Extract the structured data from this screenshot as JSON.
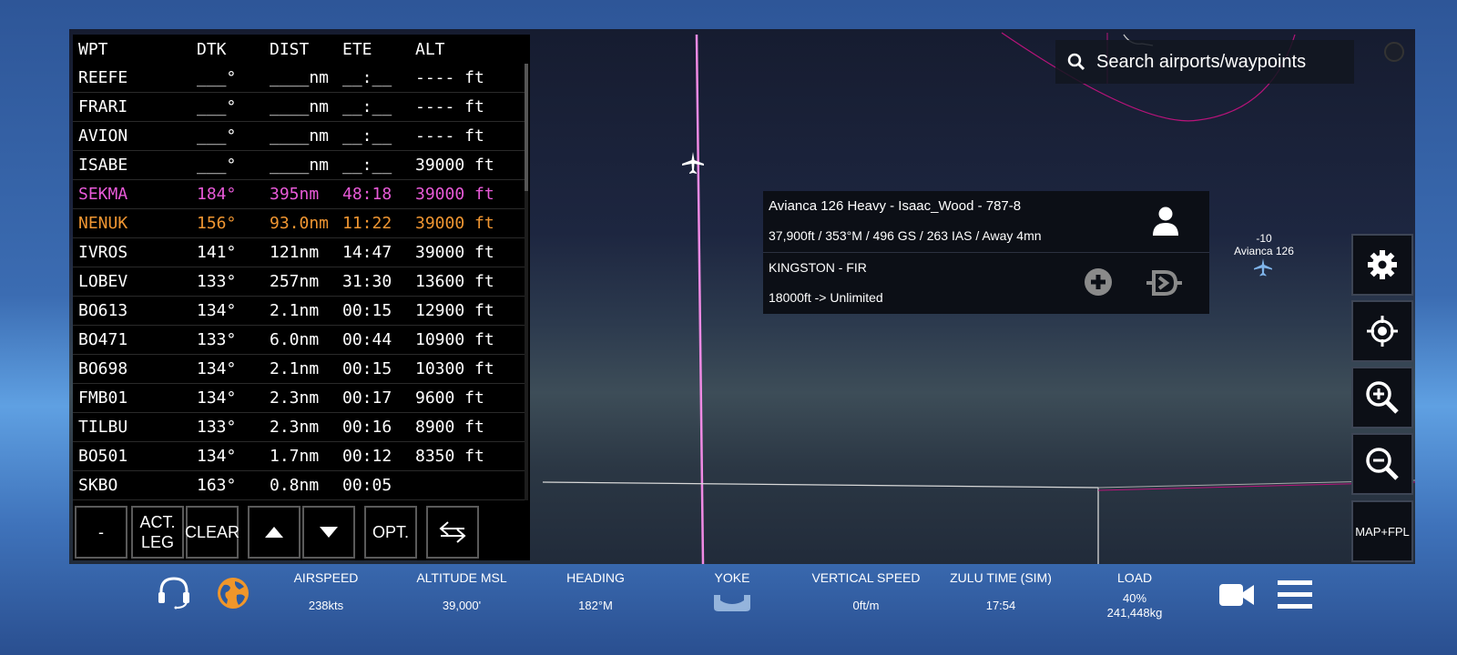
{
  "search": {
    "placeholder": "Search airports/waypoints"
  },
  "flight_plan": {
    "headers": {
      "wpt": "WPT",
      "dtk": "DTK",
      "dist": "DIST",
      "ete": "ETE",
      "alt": "ALT"
    },
    "rows": [
      {
        "wpt": "REEFE",
        "dtk": "___°",
        "dist": "____nm",
        "ete": "__:__",
        "alt": "---- ft",
        "state": "normal"
      },
      {
        "wpt": "FRARI",
        "dtk": "___°",
        "dist": "____nm",
        "ete": "__:__",
        "alt": "---- ft",
        "state": "normal"
      },
      {
        "wpt": "AVION",
        "dtk": "___°",
        "dist": "____nm",
        "ete": "__:__",
        "alt": "---- ft",
        "state": "normal"
      },
      {
        "wpt": "ISABE",
        "dtk": "___°",
        "dist": "____nm",
        "ete": "__:__",
        "alt": "39000 ft",
        "state": "normal"
      },
      {
        "wpt": "SEKMA",
        "dtk": "184°",
        "dist": "395nm",
        "ete": "48:18",
        "alt": "39000 ft",
        "state": "active"
      },
      {
        "wpt": "NENUK",
        "dtk": "156°",
        "dist": "93.0nm",
        "ete": "11:22",
        "alt": "39000 ft",
        "state": "next"
      },
      {
        "wpt": "IVROS",
        "dtk": "141°",
        "dist": "121nm",
        "ete": "14:47",
        "alt": "39000 ft",
        "state": "normal"
      },
      {
        "wpt": "LOBEV",
        "dtk": "133°",
        "dist": "257nm",
        "ete": "31:30",
        "alt": "13600 ft",
        "state": "normal"
      },
      {
        "wpt": "BO613",
        "dtk": "134°",
        "dist": "2.1nm",
        "ete": "00:15",
        "alt": "12900 ft",
        "state": "normal"
      },
      {
        "wpt": "BO471",
        "dtk": "133°",
        "dist": "6.0nm",
        "ete": "00:44",
        "alt": "10900 ft",
        "state": "normal"
      },
      {
        "wpt": "BO698",
        "dtk": "134°",
        "dist": "2.1nm",
        "ete": "00:15",
        "alt": "10300 ft",
        "state": "normal"
      },
      {
        "wpt": "FMB01",
        "dtk": "134°",
        "dist": "2.3nm",
        "ete": "00:17",
        "alt": "9600 ft",
        "state": "normal"
      },
      {
        "wpt": "TILBU",
        "dtk": "133°",
        "dist": "2.3nm",
        "ete": "00:16",
        "alt": "8900 ft",
        "state": "normal"
      },
      {
        "wpt": "BO501",
        "dtk": "134°",
        "dist": "1.7nm",
        "ete": "00:12",
        "alt": "8350 ft",
        "state": "normal"
      },
      {
        "wpt": "SKBO",
        "dtk": "163°",
        "dist": "0.8nm",
        "ete": "00:05",
        "alt": "",
        "state": "normal"
      }
    ],
    "buttons": {
      "minus": "-",
      "act_leg": "ACT.\nLEG",
      "clear": "CLEAR",
      "opt": "OPT."
    }
  },
  "info_card": {
    "title": "Avianca 126 Heavy - Isaac_Wood - 787-8",
    "stats": "37,900ft / 353°M / 496 GS / 263 IAS / Away  4mn",
    "fir": "KINGSTON - FIR",
    "range": "18000ft -> Unlimited"
  },
  "traffic": {
    "alt_delta": "-10",
    "callsign": "Avianca 126"
  },
  "right_controls": {
    "map_fpl": "MAP+FPL"
  },
  "bottom_bar": {
    "airspeed": {
      "label": "AIRSPEED",
      "value": "238kts"
    },
    "altitude": {
      "label": "ALTITUDE MSL",
      "value": "39,000'"
    },
    "heading": {
      "label": "HEADING",
      "value": "182°M"
    },
    "yoke": {
      "label": "YOKE"
    },
    "vspeed": {
      "label": "VERTICAL SPEED",
      "value": "0ft/m"
    },
    "zulu": {
      "label": "ZULU TIME (SIM)",
      "value": "17:54"
    },
    "load": {
      "label": "LOAD",
      "percent": "40%",
      "weight": "241,448kg"
    }
  },
  "colors": {
    "route_active": "#e85ad8",
    "route_next": "#f09632",
    "accent_globe": "#f0962a"
  }
}
